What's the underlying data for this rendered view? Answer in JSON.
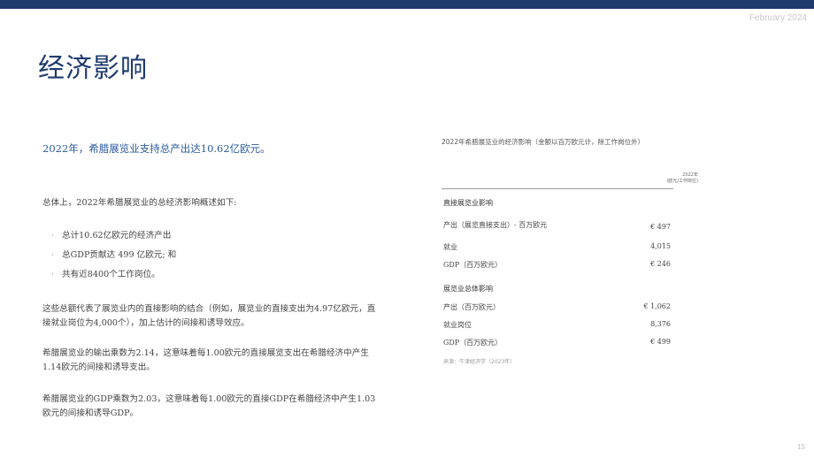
{
  "header": {
    "date": "February 2024"
  },
  "title": "经济影响",
  "lead": "2022年，希腊展览业支持总产出达10.62亿欧元。",
  "intro": "总体上，2022年希腊展览业的总经济影响概述如下:",
  "bullets": [
    "总计10.62亿欧元的经济产出",
    "总GDP贡献达 499 亿欧元; 和",
    "共有近8400个工作岗位。"
  ],
  "para1": "这些总额代表了展览业内的直接影响的结合（例如，展览业的直接支出为4.97亿欧元，直接就业岗位为4,000个），加上估计的间接和诱导效应。",
  "para2": "希腊展览业的输出乘数为2.14，这意味着每1.00欧元的直接展览支出在希腊经济中产生1.14欧元的间接和诱导支出。",
  "para3": "希腊展览业的GDP乘数为2.03，这意味着每1.00欧元的直接GDP在希腊经济中产生1.03欧元的间接和诱导GDP。",
  "table": {
    "title": "2022年希腊展览业的经济影响（金额以百万欧元计，除工作岗位外）",
    "col_year": "2022年",
    "col_sub": "(欧元/工作岗位)",
    "sections": [
      {
        "heading": "直接展览业影响",
        "rows": [
          {
            "label": "产出（展览直接支出）- 百万欧元",
            "value": "€ 497"
          },
          {
            "label": "就业",
            "value": "4,015"
          },
          {
            "label": "GDP（百万欧元）",
            "value": "€ 246"
          }
        ]
      },
      {
        "heading": "展览业总体影响",
        "rows": [
          {
            "label": "产出（百万欧元）",
            "value": "€ 1,062"
          },
          {
            "label": "就业岗位",
            "value": "8,376"
          },
          {
            "label": "GDP（百万欧元）",
            "value": "€ 499"
          }
        ]
      }
    ],
    "source": "来源：牛津经济学（2023年）"
  },
  "page_number": "15",
  "colors": {
    "brand": "#1f3b6e",
    "lead": "#2b5aa0"
  }
}
